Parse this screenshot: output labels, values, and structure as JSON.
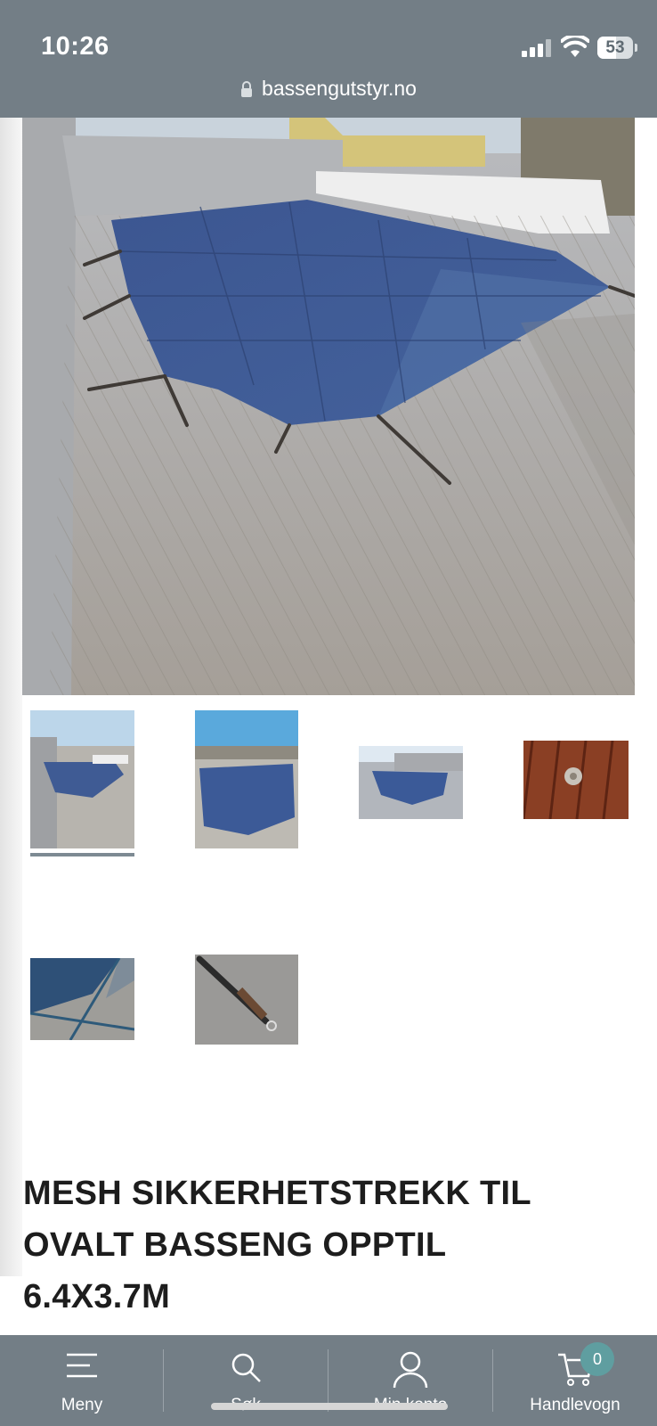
{
  "status_bar": {
    "time": "10:26",
    "battery": "53"
  },
  "browser": {
    "url": "bassengutstyr.no"
  },
  "product": {
    "title_lines": [
      "MESH SIKKERHETSTREKK TIL",
      "OVALT BASSENG OPPTIL",
      "6.4X3.7M"
    ],
    "thumbnail_count": 6,
    "active_thumbnail": 1
  },
  "bottom_nav": {
    "items": [
      {
        "label": "Meny",
        "icon": "menu-icon"
      },
      {
        "label": "Søk",
        "icon": "search-icon"
      },
      {
        "label": "Min konto",
        "icon": "account-icon"
      },
      {
        "label": "Handlevogn",
        "icon": "cart-icon"
      }
    ],
    "cart_count": "0"
  }
}
